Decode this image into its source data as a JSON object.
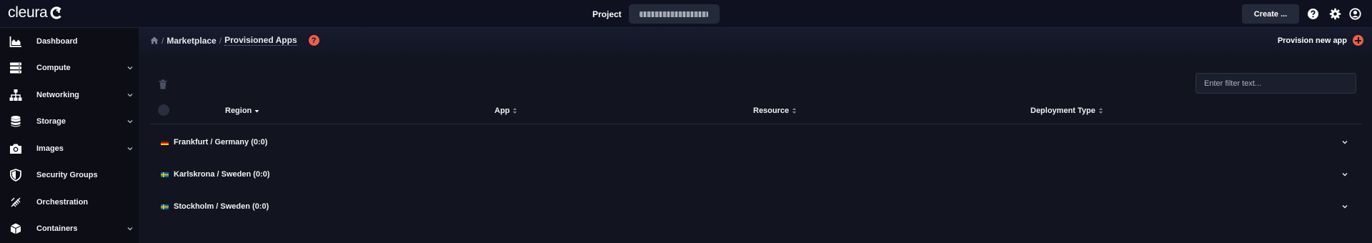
{
  "topbar": {
    "logo_text": "cleura",
    "project_label": "Project",
    "create_label": "Create ..."
  },
  "sidebar": {
    "items": [
      {
        "label": "Dashboard",
        "icon": "chart-icon",
        "expandable": false
      },
      {
        "label": "Compute",
        "icon": "server-icon",
        "expandable": true
      },
      {
        "label": "Networking",
        "icon": "network-icon",
        "expandable": true
      },
      {
        "label": "Storage",
        "icon": "database-icon",
        "expandable": true
      },
      {
        "label": "Images",
        "icon": "camera-icon",
        "expandable": true
      },
      {
        "label": "Security Groups",
        "icon": "shield-icon",
        "expandable": false
      },
      {
        "label": "Orchestration",
        "icon": "orchestration-icon",
        "expandable": false
      },
      {
        "label": "Containers",
        "icon": "box-icon",
        "expandable": true
      }
    ]
  },
  "breadcrumb": {
    "items": [
      "Marketplace",
      "Provisioned Apps"
    ],
    "separator": "/",
    "help_label": "?"
  },
  "actions": {
    "provision_label": "Provision new app"
  },
  "filter": {
    "placeholder": "Enter filter text..."
  },
  "table": {
    "columns": [
      {
        "label": "Region",
        "sort": "desc"
      },
      {
        "label": "App",
        "sort": "none"
      },
      {
        "label": "Resource",
        "sort": "none"
      },
      {
        "label": "Deployment Type",
        "sort": "none"
      }
    ],
    "groups": [
      {
        "label": "Frankfurt / Germany",
        "count": "(0:0)",
        "flag": "de"
      },
      {
        "label": "Karlskrona / Sweden",
        "count": "(0:0)",
        "flag": "se"
      },
      {
        "label": "Stockholm / Sweden",
        "count": "(0:0)",
        "flag": "se"
      }
    ]
  },
  "colors": {
    "accent": "#ee5f49",
    "background": "#12141f",
    "sidebar": "#0c0d15"
  }
}
